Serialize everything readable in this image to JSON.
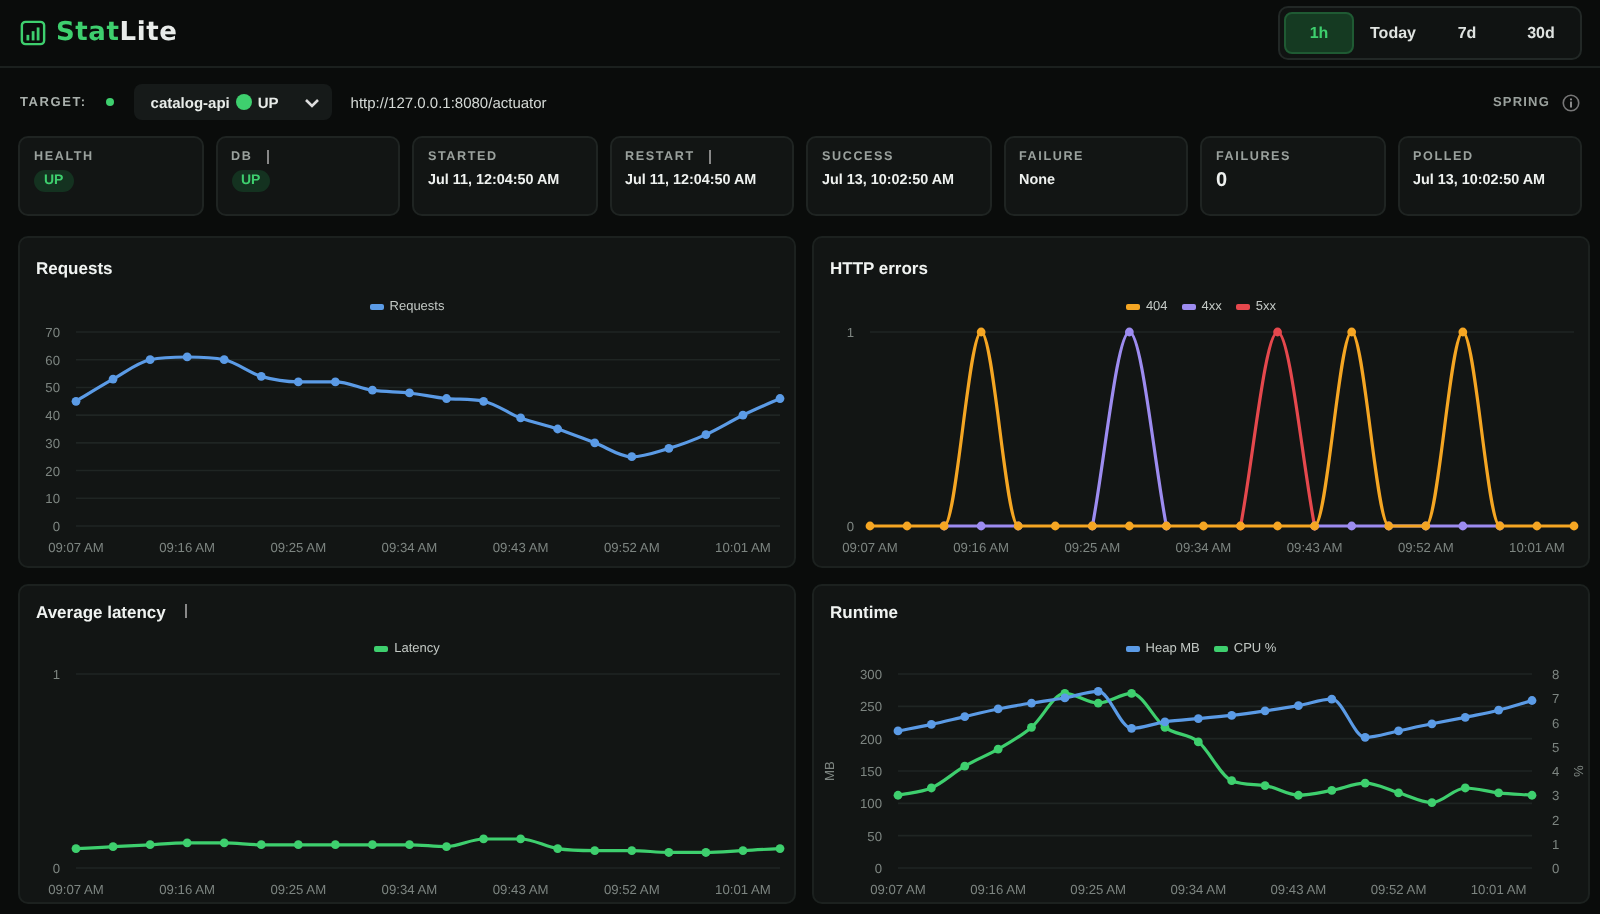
{
  "header": {
    "logo": {
      "prefix": "Stat",
      "suffix": "Lite"
    },
    "ranges": [
      {
        "label": "1h",
        "selected": true
      },
      {
        "label": "Today",
        "selected": false
      },
      {
        "label": "7d",
        "selected": false
      },
      {
        "label": "30d",
        "selected": false
      }
    ]
  },
  "target": {
    "label": "TARGET:",
    "online": true,
    "service": "catalog-api",
    "status": "UP",
    "url": "http://127.0.0.1:8080/actuator",
    "framework": "SPRING"
  },
  "stats": [
    {
      "label": "HEALTH",
      "info": false,
      "kind": "badge",
      "value": "UP"
    },
    {
      "label": "DB",
      "info": true,
      "kind": "badge",
      "value": "UP"
    },
    {
      "label": "STARTED",
      "info": false,
      "kind": "text",
      "value": "Jul 11, 12:04:50 AM"
    },
    {
      "label": "RESTART",
      "info": true,
      "kind": "text",
      "value": "Jul 11, 12:04:50 AM"
    },
    {
      "label": "SUCCESS",
      "info": false,
      "kind": "text",
      "value": "Jul 13, 10:02:50 AM"
    },
    {
      "label": "FAILURE",
      "info": false,
      "kind": "text",
      "value": "None"
    },
    {
      "label": "FAILURES",
      "info": false,
      "kind": "number",
      "value": "0"
    },
    {
      "label": "POLLED",
      "info": false,
      "kind": "text",
      "value": "Jul 13, 10:02:50 AM"
    }
  ],
  "charts": [
    {
      "title": "Requests",
      "info": false,
      "chart_data": {
        "type": "line",
        "categories": [
          "09:07 AM",
          null,
          null,
          "09:16 AM",
          null,
          null,
          "09:25 AM",
          null,
          null,
          "09:34 AM",
          null,
          null,
          "09:43 AM",
          null,
          null,
          "09:52 AM",
          null,
          null,
          "10:01 AM",
          null
        ],
        "grid": true,
        "ylim": [
          0,
          70
        ],
        "yticks": [
          0,
          10,
          20,
          30,
          40,
          50,
          60,
          70
        ],
        "series": [
          {
            "name": "Requests",
            "color": "#5b9be6",
            "marker": "circle",
            "values": [
              45,
              53,
              60,
              61,
              60,
              54,
              52,
              52,
              49,
              48,
              46,
              45,
              39,
              35,
              30,
              25,
              28,
              33,
              40,
              46
            ]
          }
        ]
      }
    },
    {
      "title": "HTTP errors",
      "info": false,
      "chart_data": {
        "type": "line",
        "categories": [
          "09:07 AM",
          null,
          null,
          "09:16 AM",
          null,
          null,
          "09:25 AM",
          null,
          null,
          "09:34 AM",
          null,
          null,
          "09:43 AM",
          null,
          null,
          "09:52 AM",
          null,
          null,
          "10:01 AM",
          null
        ],
        "grid": true,
        "ylim": [
          0,
          1
        ],
        "yticks": [
          0,
          1
        ],
        "series": [
          {
            "name": "404",
            "color": "#f5a623",
            "marker": "circle",
            "values": [
              0,
              0,
              0,
              1,
              0,
              0,
              0,
              0,
              0,
              0,
              0,
              0,
              0,
              1,
              0,
              0,
              1,
              0,
              0,
              0
            ]
          },
          {
            "name": "4xx",
            "color": "#9d8cf0",
            "marker": "circle",
            "values": [
              null,
              null,
              0,
              0,
              0,
              null,
              0,
              1,
              0,
              null,
              null,
              null,
              0,
              0,
              0,
              0,
              0,
              0,
              null,
              null
            ]
          },
          {
            "name": "5xx",
            "color": "#e5484d",
            "marker": "circle",
            "values": [
              null,
              null,
              null,
              null,
              null,
              null,
              null,
              null,
              null,
              null,
              0,
              1,
              0,
              null,
              null,
              null,
              null,
              null,
              null,
              null
            ]
          }
        ]
      }
    },
    {
      "title": "Average latency",
      "info": true,
      "chart_data": {
        "type": "line",
        "categories": [
          "09:07 AM",
          null,
          null,
          "09:16 AM",
          null,
          null,
          "09:25 AM",
          null,
          null,
          "09:34 AM",
          null,
          null,
          "09:43 AM",
          null,
          null,
          "09:52 AM",
          null,
          null,
          "10:01 AM",
          null
        ],
        "grid": true,
        "ylim": [
          0,
          1
        ],
        "yticks": [
          0,
          1
        ],
        "series": [
          {
            "name": "Latency",
            "color": "#3ecf6e",
            "marker": "circle",
            "values": [
              0.1,
              0.11,
              0.12,
              0.13,
              0.13,
              0.12,
              0.12,
              0.12,
              0.12,
              0.12,
              0.11,
              0.15,
              0.15,
              0.1,
              0.09,
              0.09,
              0.08,
              0.08,
              0.09,
              0.1
            ]
          }
        ]
      }
    },
    {
      "title": "Runtime",
      "info": false,
      "chart_data": {
        "type": "line",
        "categories": [
          "09:07 AM",
          null,
          null,
          "09:16 AM",
          null,
          null,
          "09:25 AM",
          null,
          null,
          "09:34 AM",
          null,
          null,
          "09:43 AM",
          null,
          null,
          "09:52 AM",
          null,
          null,
          "10:01 AM",
          null
        ],
        "grid": true,
        "ylabel": "MB",
        "y2label": "%",
        "ylim": [
          0,
          300
        ],
        "yticks": [
          0,
          50,
          100,
          150,
          200,
          250,
          300
        ],
        "y2lim": [
          0,
          8
        ],
        "y2ticks": [
          0,
          1,
          2,
          3,
          4,
          5,
          6,
          7,
          8
        ],
        "series": [
          {
            "name": "Heap MB",
            "color": "#5b9be6",
            "marker": "circle",
            "values": [
              212,
              222,
              234,
              246,
              255,
              263,
              273,
              216,
              226,
              231,
              236,
              243,
              251,
              261,
              202,
              212,
              223,
              233,
              244,
              259
            ]
          },
          {
            "name": "CPU %",
            "color": "#3ecf6e",
            "axis": "y2",
            "marker": "circle",
            "values": [
              3.0,
              3.3,
              4.2,
              4.9,
              5.8,
              7.2,
              6.8,
              7.2,
              5.8,
              5.2,
              3.6,
              3.4,
              3.0,
              3.2,
              3.5,
              3.1,
              2.7,
              3.3,
              3.1,
              3.0
            ]
          }
        ]
      }
    }
  ]
}
